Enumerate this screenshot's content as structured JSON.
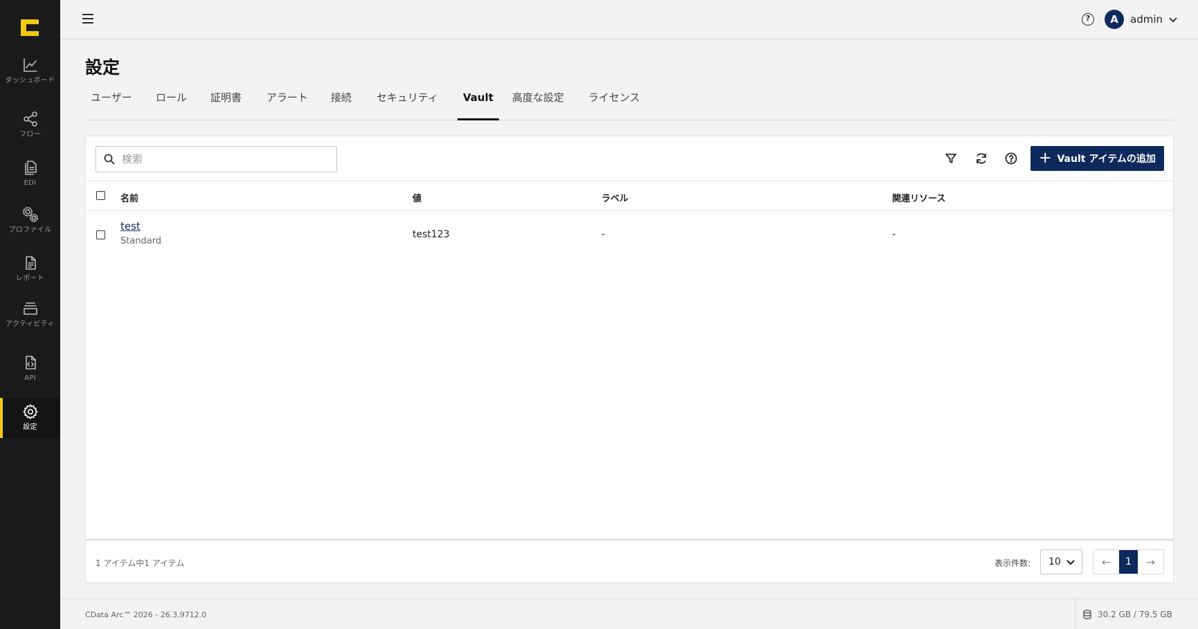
{
  "sidebar": {
    "items": [
      {
        "label": "ダッシュボード",
        "icon": "chart-line-icon"
      },
      {
        "label": "フロー",
        "icon": "share-nodes-icon"
      },
      {
        "label": "EDI",
        "icon": "documents-icon"
      },
      {
        "label": "プロファイル",
        "icon": "gears-icon"
      },
      {
        "label": "レポート",
        "icon": "report-document-icon"
      },
      {
        "label": "アクティビティ",
        "icon": "layers-icon"
      },
      {
        "label": "API",
        "icon": "code-file-icon"
      },
      {
        "label": "設定",
        "icon": "gear-icon"
      }
    ],
    "active_index": 7,
    "accent_color": "#f2c811"
  },
  "header": {
    "username": "admin",
    "avatar_initial": "A"
  },
  "page": {
    "title": "設定",
    "tabs": [
      "ユーザー",
      "ロール",
      "証明書",
      "アラート",
      "接続",
      "セキュリティ",
      "Vault",
      "高度な設定",
      "ライセンス"
    ],
    "active_tab": "Vault"
  },
  "toolbar": {
    "search_placeholder": "検索",
    "add_button_label": "Vault アイテムの追加"
  },
  "table": {
    "columns": [
      "名前",
      "値",
      "ラベル",
      "関連リソース"
    ],
    "rows": [
      {
        "name": "test",
        "type": "Standard",
        "value": "test123",
        "label": "-",
        "related": "-"
      }
    ]
  },
  "footer": {
    "count_text": "1 アイテム中1 アイテム",
    "per_page_label": "表示件数:",
    "per_page_value": "10",
    "current_page": "1",
    "prev_arrow": "←",
    "next_arrow": "→"
  },
  "status": {
    "version": "CData Arc™ 2026 - 26.3.9712.0",
    "storage": "30.2 GB / 79.5 GB"
  },
  "colors": {
    "primary": "#0e2a5c",
    "sidebar_bg": "#1a1a1a"
  }
}
